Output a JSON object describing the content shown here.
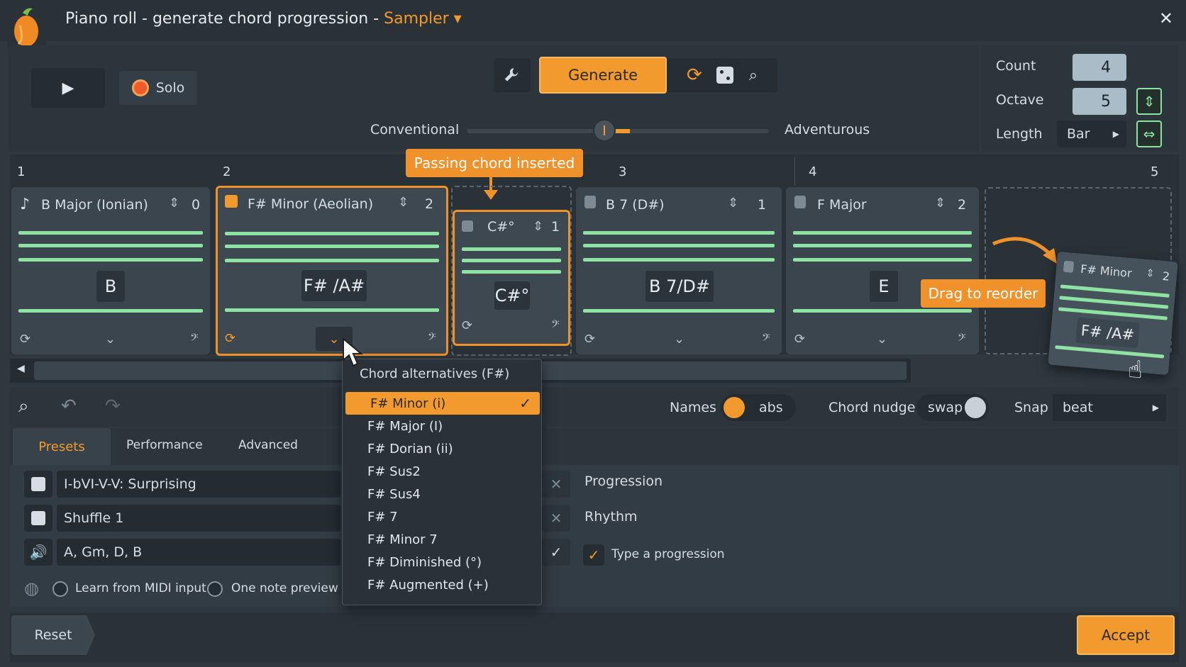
{
  "window": {
    "title": "Piano roll - generate chord progression - ",
    "instrument": "Sampler",
    "close": "✕"
  },
  "transport": {
    "play": "▶",
    "solo": "Solo"
  },
  "toolbar": {
    "generate": "Generate",
    "conventional": "Conventional",
    "adventurous": "Adventurous",
    "slider_level": 0.45
  },
  "settings": {
    "count_label": "Count",
    "count": "4",
    "octave_label": "Octave",
    "octave": "5",
    "length_label": "Length",
    "length": "Bar"
  },
  "timeline": {
    "m1": "1",
    "m2": "2",
    "m3": "3",
    "m4": "4",
    "m5": "5"
  },
  "callouts": {
    "passing": "Passing chord inserted",
    "drag": "Drag to reorder"
  },
  "chords": [
    {
      "name": "B Major (Ionian)",
      "num": "0",
      "note": "B"
    },
    {
      "name": "F# Minor (Aeolian)",
      "num": "2",
      "note": "F# /A#"
    },
    {
      "name": "C#°",
      "num": "1",
      "note": "C#°"
    },
    {
      "name": "B 7 (D#)",
      "num": "1",
      "note": "B 7/D#"
    },
    {
      "name": "F Major",
      "num": "2",
      "note": "E"
    },
    {
      "name": "F# Minor",
      "num": "2",
      "note": "F# /A#"
    }
  ],
  "menu": {
    "title": "Chord alternatives (F#)",
    "items": [
      "F# Minor (i)",
      "F# Major (I)",
      "F# Dorian (ii)",
      "F# Sus2",
      "F# Sus4",
      "F# 7",
      "F# Minor 7",
      "F# Diminished (°)",
      "F# Augmented (+)"
    ]
  },
  "options": {
    "names": "Names",
    "names_val": "abs",
    "nudge": "Chord nudge",
    "nudge_val": "swap",
    "snap": "Snap",
    "snap_val": "beat"
  },
  "tabs": [
    "Presets",
    "Performance",
    "Advanced"
  ],
  "presets": [
    "I-bVI-V-V: Surprising",
    "Shuffle 1",
    "A, Gm, D, B"
  ],
  "right": {
    "progression": "Progression",
    "rhythm": "Rhythm",
    "type": "Type a progression"
  },
  "bottom": {
    "learn": "Learn from MIDI input",
    "preview": "One note preview",
    "reset": "Reset",
    "accept": "Accept"
  },
  "colors": {
    "accent": "#f39a2e",
    "green": "#8ee3a3"
  }
}
